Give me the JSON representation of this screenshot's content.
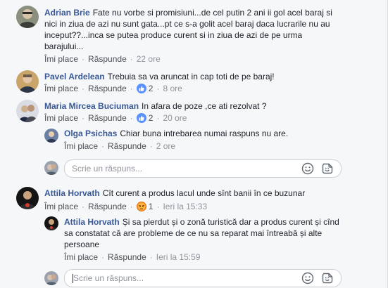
{
  "comments": [
    {
      "author": "Adrian Brie",
      "text": "Fate nu vorbe si promisiuni...de cel putin 2 ani ii gol acel baraj si nici in ziua de azi nu sunt gata...pt ce s-a golit acel baraj daca lucrarile nu au inceput??...inca se putea produce curent si in ziua de azi de pe urma barajului...",
      "like": "Îmi place",
      "reply": "Răspunde",
      "time": "22 ore"
    },
    {
      "author": "Pavel Ardelean",
      "text": "Trebuia sa va aruncat in cap toti de pe baraj!",
      "like": "Îmi place",
      "reply": "Răspunde",
      "reactions": "2",
      "time": "8 ore"
    },
    {
      "author": "Maria Mircea Buciuman",
      "text": "In afara de poze ,ce ati rezolvat ?",
      "like": "Îmi place",
      "reply": "Răspunde",
      "reactions": "2",
      "time": "20 ore"
    },
    {
      "author": "Olga Psichas",
      "text": "Chiar buna intrebarea numai raspuns nu are.",
      "like": "Îmi place",
      "reply": "Răspunde",
      "time": "2 ore"
    },
    {
      "author": "Attila Horvath",
      "text": "Cît curent a produs lacul unde sînt banii în ce buzunar",
      "like": "Îmi place",
      "reply": "Răspunde",
      "reactions": "1",
      "time": "Ieri la 15:33"
    },
    {
      "author": "Attila Horvath",
      "text": "Și sa pierdut și o zonă turistică dar a produs curent și cînd sa constatat că are probleme de ce nu sa reparat mai întreabă și alte persoane",
      "like": "Îmi place",
      "reply": "Răspunde",
      "time": "Ieri la 15:59"
    }
  ],
  "reply_boxes": [
    {
      "placeholder": "Scrie un răspuns..."
    },
    {
      "placeholder": "Scrie un răspuns..."
    }
  ],
  "icons": {
    "like": "thumbs-up-icon",
    "angry": "angry-face-icon",
    "emoji": "smiley-icon",
    "sticker": "sticker-icon"
  },
  "colors": {
    "author": "#385898",
    "link": "#4b4f56",
    "meta": "#90949c",
    "like_badge": "#5890ff",
    "angry_badge": "#e9710f"
  }
}
